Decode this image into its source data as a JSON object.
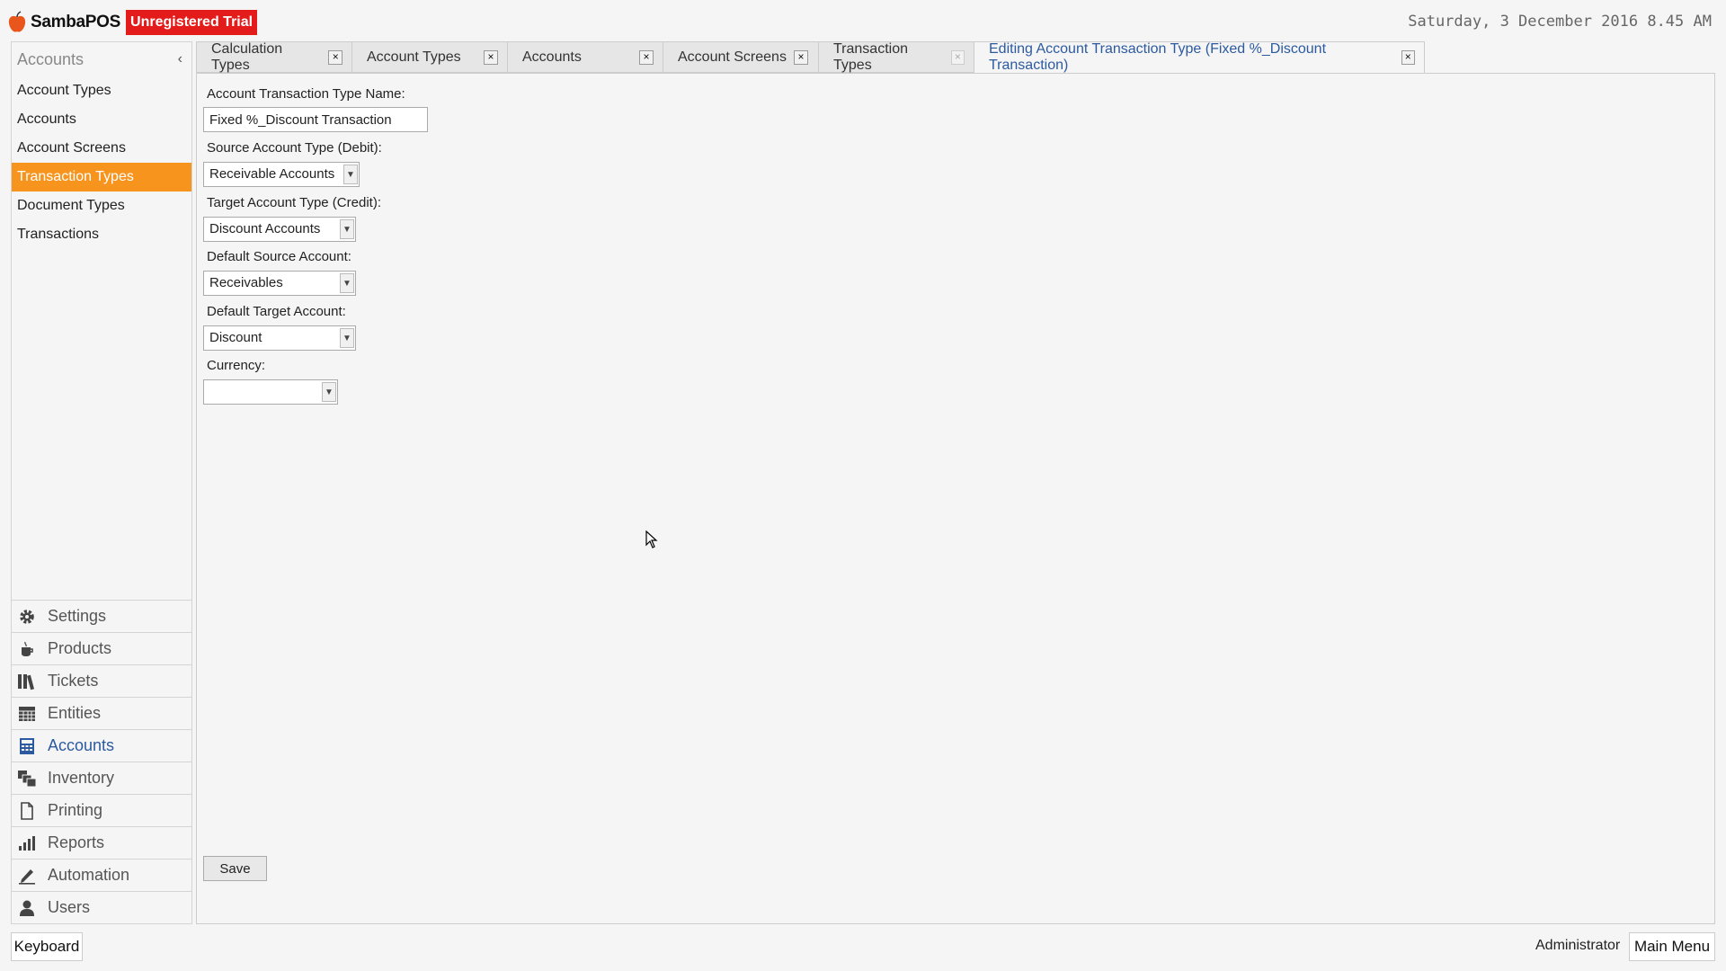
{
  "header": {
    "app_name": "SambaPOS",
    "trial_label": "Unregistered Trial",
    "datetime": "Saturday, 3 December 2016 8.45 AM",
    "logo_color": "#e8561c"
  },
  "sidebar": {
    "title": "Accounts",
    "items": [
      {
        "label": "Account Types"
      },
      {
        "label": "Accounts"
      },
      {
        "label": "Account Screens"
      },
      {
        "label": "Transaction Types",
        "active": true
      },
      {
        "label": "Document Types"
      },
      {
        "label": "Transactions"
      }
    ],
    "accent_color": "#f7941d"
  },
  "modules": [
    {
      "label": "Settings",
      "icon": "gear-icon"
    },
    {
      "label": "Products",
      "icon": "coffee-cup-icon"
    },
    {
      "label": "Tickets",
      "icon": "books-icon"
    },
    {
      "label": "Entities",
      "icon": "grid-table-icon"
    },
    {
      "label": "Accounts",
      "icon": "calculator-icon",
      "active": true
    },
    {
      "label": "Inventory",
      "icon": "stack-icon"
    },
    {
      "label": "Printing",
      "icon": "document-icon"
    },
    {
      "label": "Reports",
      "icon": "bar-chart-icon"
    },
    {
      "label": "Automation",
      "icon": "pencil-icon"
    },
    {
      "label": "Users",
      "icon": "user-icon"
    }
  ],
  "tabs": [
    {
      "label": "Calculation Types",
      "close": "×"
    },
    {
      "label": "Account Types",
      "close": "×"
    },
    {
      "label": "Accounts",
      "close": "×"
    },
    {
      "label": "Account Screens",
      "close": "×"
    },
    {
      "label": "Transaction Types",
      "close": "×"
    },
    {
      "label": "Editing Account Transaction Type (Fixed %_Discount Transaction)",
      "close": "×",
      "active": true
    }
  ],
  "form": {
    "name_label": "Account Transaction Type Name:",
    "name_value": "Fixed %_Discount Transaction",
    "source_type_label": "Source Account Type (Debit):",
    "source_type_value": "Receivable Accounts",
    "target_type_label": "Target Account Type (Credit):",
    "target_type_value": "Discount Accounts",
    "default_source_label": "Default Source Account:",
    "default_source_value": "Receivables",
    "default_target_label": "Default Target Account:",
    "default_target_value": "Discount",
    "currency_label": "Currency:",
    "currency_value": "",
    "save_label": "Save"
  },
  "footer": {
    "keyboard_label": "Keyboard",
    "user": "Administrator",
    "main_menu_label": "Main Menu"
  }
}
